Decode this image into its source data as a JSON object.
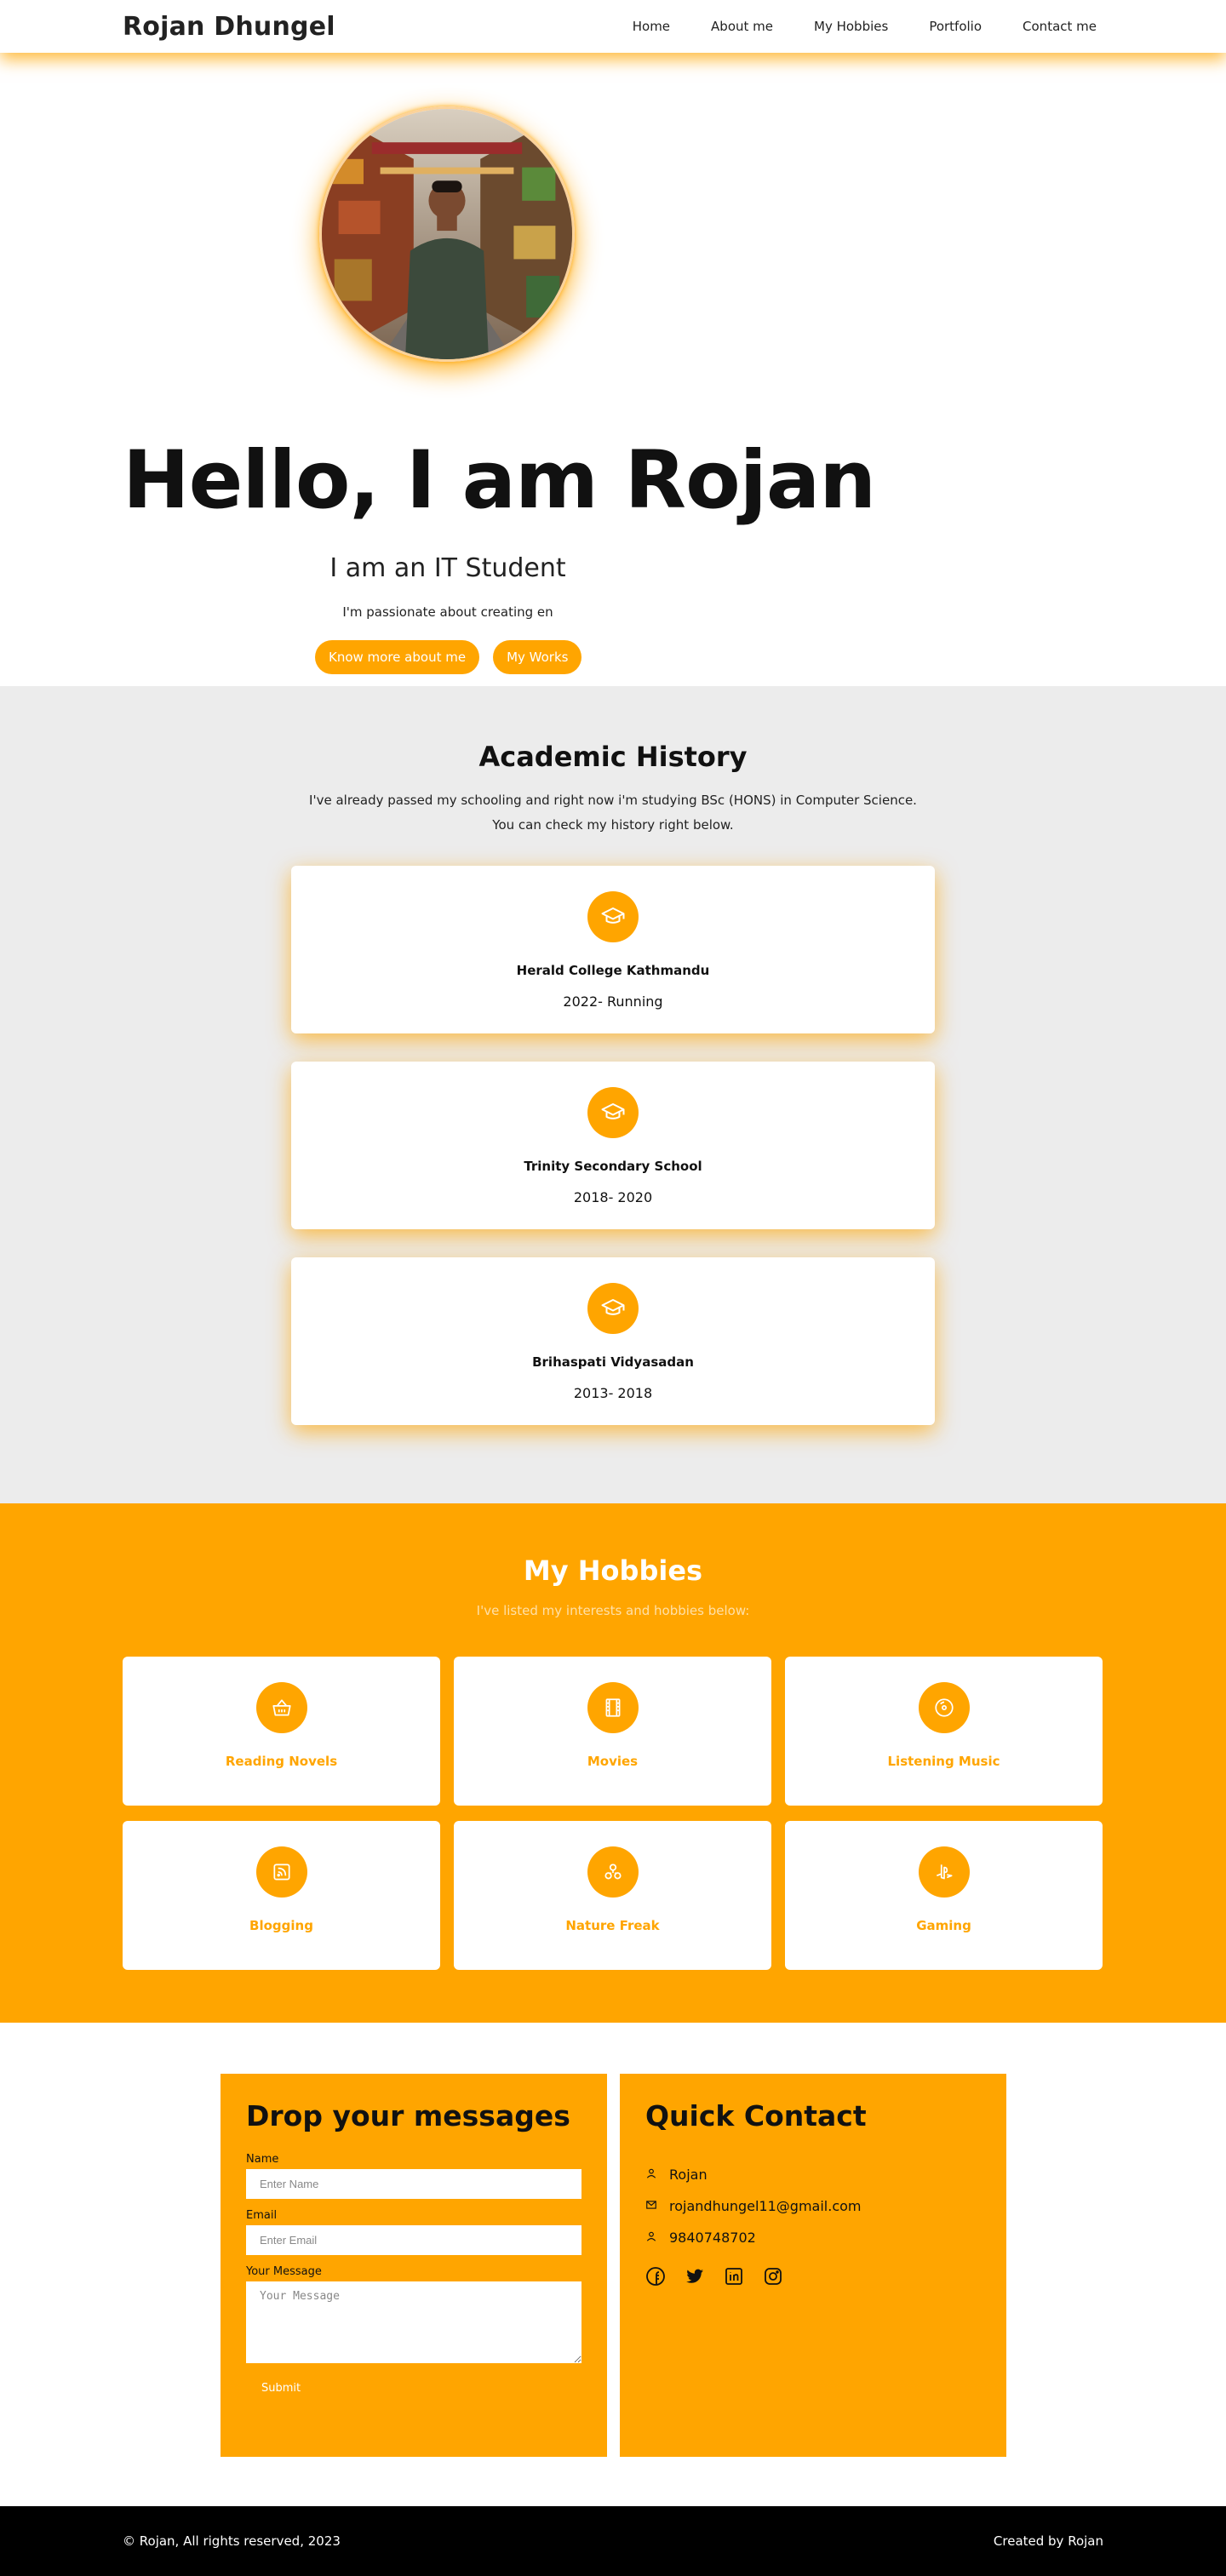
{
  "nav": {
    "brand": "Rojan Dhungel",
    "items": [
      "Home",
      "About me",
      "My Hobbies",
      "Portfolio",
      "Contact me"
    ]
  },
  "hero": {
    "title": "Hello, I am Rojan",
    "subtitle": "I am an IT Student",
    "description": "I'm passionate about creating en",
    "buttons": [
      "Know more about me",
      "My Works"
    ]
  },
  "academic": {
    "title": "Academic History",
    "description_line1": "I've already passed my schooling and right now i'm studying BSc (HONS) in Computer Science.",
    "description_line2": "You can check my history right below.",
    "items": [
      {
        "name": "Herald College Kathmandu",
        "years": "2022- Running",
        "icon": "graduation-cap-icon"
      },
      {
        "name": "Trinity Secondary School",
        "years": "2018- 2020",
        "icon": "graduation-cap-icon"
      },
      {
        "name": "Brihaspati Vidyasadan",
        "years": "2013- 2018",
        "icon": "graduation-cap-icon"
      }
    ]
  },
  "hobbies": {
    "title": "My Hobbies",
    "description": "I've listed my interests and hobbies below:",
    "items": [
      {
        "label": "Reading Novels",
        "icon": "basket-icon"
      },
      {
        "label": "Movies",
        "icon": "film-icon"
      },
      {
        "label": "Listening Music",
        "icon": "disc-icon"
      },
      {
        "label": "Blogging",
        "icon": "rss-icon"
      },
      {
        "label": "Nature Freak",
        "icon": "nature-icon"
      },
      {
        "label": "Gaming",
        "icon": "playstation-icon"
      }
    ]
  },
  "contact": {
    "form_title": "Drop your messages",
    "name_label": "Name",
    "name_placeholder": "Enter Name",
    "email_label": "Email",
    "email_placeholder": "Enter Email",
    "message_label": "Your Message",
    "message_placeholder": "Your Message",
    "submit_label": "Submit",
    "quick_title": "Quick Contact",
    "person": "Rojan",
    "email": "rojandhungel11@gmail.com",
    "phone": "9840748702"
  },
  "footer": {
    "copyright": "© Rojan, All rights reserved, 2023",
    "credit": "Created by Rojan"
  },
  "colors": {
    "accent": "#ffa500",
    "section_gray": "#ececec",
    "footer_bg": "#000000"
  }
}
